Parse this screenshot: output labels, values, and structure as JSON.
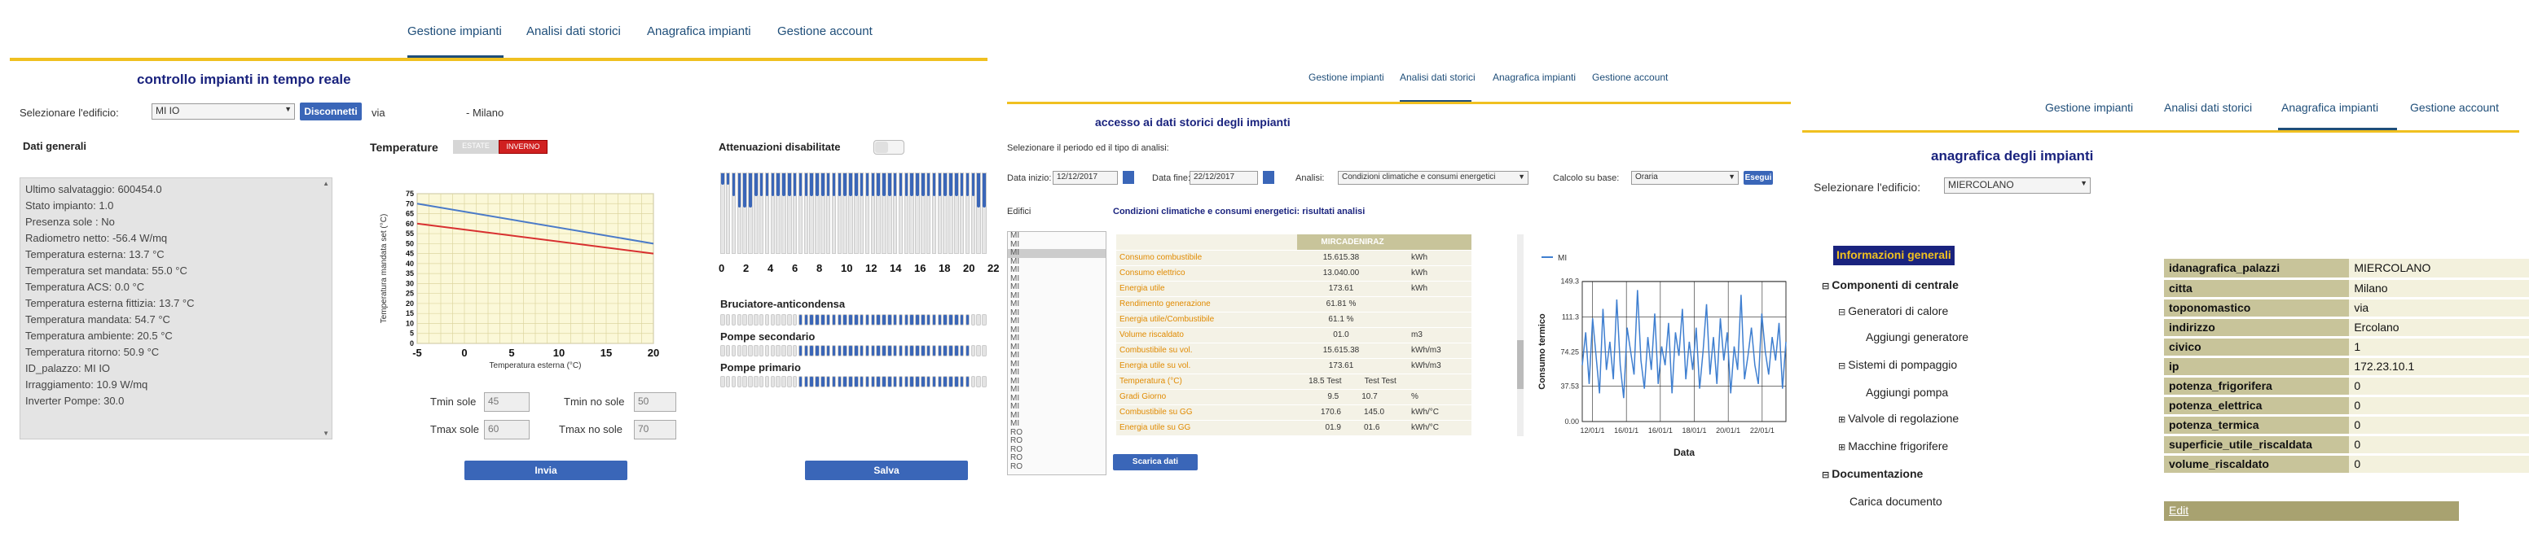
{
  "page1": {
    "nav": [
      "Gestione impianti",
      "Analisi dati storici",
      "Anagrafica impianti",
      "Gestione account"
    ],
    "title": "controllo impianti in tempo reale",
    "select_label": "Selezionare l'edificio:",
    "select_value": "MI                    IO",
    "disconnect_label": "Disconnetti",
    "address_via": "via",
    "address_city": "- Milano",
    "dati_generali_title": "Dati generali",
    "dati_generali_lines": [
      "Ultimo salvataggio: 600454.0",
      "Stato impianto: 1.0",
      "Presenza sole : No",
      "Radiometro netto: -56.4 W/mq",
      "Temperatura esterna: 13.7 °C",
      "Temperatura set mandata: 55.0 °C",
      "Temperatura ACS: 0.0 °C",
      "Temperatura esterna fittizia: 13.7 °C",
      "Temperatura mandata: 54.7 °C",
      "Temperatura ambiente: 20.5 °C",
      "Temperatura ritorno: 50.9 °C",
      "ID_palazzo: MI                    IO",
      "Irraggiamento: 10.9 W/mq",
      "Inverter Pompe: 30.0"
    ],
    "temperature_title": "Temperature",
    "toggle_estate": "ESTATE",
    "toggle_inverno": "INVERNO",
    "ylabel": "Temperatura mandata set (°C)",
    "xlabel": "Temperatura esterna (°C)",
    "tmin_sole_label": "Tmin sole",
    "tmin_sole_value": "45",
    "tmin_nosole_label": "Tmin no sole",
    "tmin_nosole_value": "50",
    "tmax_sole_label": "Tmax sole",
    "tmax_sole_value": "60",
    "tmax_nosole_label": "Tmax no sole",
    "tmax_nosole_value": "70",
    "invia_label": "Invia",
    "salva_label": "Salva",
    "attenuazioni_title": "Attenuazioni disabilitate",
    "attenuazioni_levels": [
      0.25,
      0.25,
      0.5,
      0.75,
      0.75,
      0.75,
      0.5,
      0.5,
      0.5,
      0.5,
      0.5,
      0.5,
      0.5,
      0.5,
      0.5,
      0.5,
      0.5,
      0.5,
      0.5,
      0.5,
      0.5,
      0.5,
      0.5,
      0.5,
      0.5,
      0.5,
      0.5,
      0.5,
      0.5,
      0.5,
      0.5,
      0.5,
      0.5,
      0.5,
      0.5,
      0.5,
      0.5,
      0.5,
      0.5,
      0.5,
      0.5,
      0.5,
      0.5,
      0.5,
      0.5,
      0.5,
      0.75,
      0.75
    ],
    "hour_ticks": [
      "0",
      "2",
      "4",
      "6",
      "8",
      "10",
      "12",
      "14",
      "16",
      "18",
      "20",
      "22"
    ],
    "bruciatore_title": "Bruciatore-anticondensa",
    "pompe_secondario_title": "Pompe secondario",
    "pompe_primario_title": "Pompe primario",
    "bruciatore_on": [
      0,
      0,
      0,
      0,
      0,
      0,
      0,
      0,
      0,
      0,
      0,
      0,
      0,
      0,
      1,
      1,
      1,
      1,
      1,
      1,
      1,
      1,
      1,
      1,
      1,
      1,
      1,
      1,
      1,
      1,
      1,
      1,
      1,
      1,
      1,
      1,
      1,
      1,
      1,
      1,
      1,
      1,
      1,
      1,
      1,
      0,
      0,
      0
    ],
    "secondario_on": [
      0,
      0,
      0,
      0,
      0,
      0,
      0,
      0,
      0,
      0,
      0,
      0,
      0,
      0,
      1,
      1,
      1,
      1,
      1,
      1,
      1,
      1,
      1,
      1,
      1,
      1,
      1,
      1,
      1,
      1,
      1,
      1,
      1,
      1,
      1,
      1,
      1,
      1,
      1,
      1,
      1,
      1,
      1,
      1,
      1,
      0,
      0,
      0
    ],
    "primario_on": [
      0,
      0,
      0,
      0,
      0,
      0,
      0,
      0,
      0,
      0,
      0,
      0,
      0,
      0,
      1,
      1,
      1,
      1,
      1,
      1,
      1,
      1,
      1,
      1,
      1,
      1,
      1,
      1,
      1,
      1,
      1,
      1,
      1,
      1,
      1,
      1,
      1,
      1,
      1,
      1,
      1,
      1,
      1,
      1,
      1,
      0,
      0,
      0
    ]
  },
  "chart_data": [
    {
      "type": "line",
      "title": "",
      "xlabel": "Temperatura esterna (°C)",
      "ylabel": "Temperatura mandata set (°C)",
      "xlim": [
        -5,
        20
      ],
      "ylim": [
        0,
        75
      ],
      "x_ticks": [
        "-5",
        "0",
        "5",
        "10",
        "15",
        "20"
      ],
      "y_ticks": [
        "0",
        "5",
        "10",
        "15",
        "20",
        "25",
        "30",
        "35",
        "40",
        "45",
        "50",
        "55",
        "60",
        "65",
        "70",
        "75"
      ],
      "series": [
        {
          "color": "#4a7ac8",
          "x": [
            -5,
            20
          ],
          "y": [
            70,
            50
          ]
        },
        {
          "color": "#d83030",
          "x": [
            -5,
            20
          ],
          "y": [
            60,
            45
          ]
        }
      ]
    },
    {
      "type": "line",
      "title": "",
      "xlabel": "Data",
      "ylabel": "Consumo termico",
      "legend": "top-left",
      "ylim": [
        0,
        149.06
      ],
      "y_ticks": [
        "0.00",
        "37.53",
        "74.25",
        "111.3",
        "149.3"
      ],
      "x_ticks": [
        "12/01/1",
        "16/01/1",
        "16/01/1",
        "18/01/1",
        "20/01/1",
        "22/01/1"
      ],
      "series": [
        {
          "name": "MI",
          "color": "#3f7fd0",
          "values": [
            60,
            95,
            40,
            110,
            70,
            30,
            120,
            55,
            85,
            45,
            130,
            60,
            25,
            100,
            75,
            50,
            140,
            65,
            35,
            90,
            55,
            115,
            40,
            80,
            60,
            105,
            30,
            95,
            70,
            120,
            45,
            85,
            55,
            100,
            35,
            75,
            125,
            50,
            90,
            40,
            110,
            65,
            95,
            30,
            80,
            55,
            135,
            45,
            70,
            100,
            60,
            40,
            115,
            75,
            50,
            90,
            65,
            105,
            35,
            85
          ]
        }
      ]
    }
  ],
  "page2": {
    "nav": [
      "Gestione impianti",
      "Analisi dati storici",
      "Anagrafica impianti",
      "Gestione account"
    ],
    "title": "accesso ai dati storici degli impianti",
    "period_label": "Selezionare il periodo ed il tipo di analisi:",
    "data_inizio_label": "Data inizio:",
    "data_inizio_value": "12/12/2017",
    "data_fine_label": "Data fine:",
    "data_fine_value": "22/12/2017",
    "analisi_label": "Analisi:",
    "analisi_value": "Condizioni climatiche e consumi energetici",
    "calcolo_label": "Calcolo su base:",
    "calcolo_value": "Oraria",
    "esegui_label": "Esegui",
    "edifici_label": "Edifici",
    "edifici_list": [
      "MI",
      "MI",
      "MI",
      "MI",
      "MI",
      "MI",
      "MI",
      "MI",
      "MI",
      "MI",
      "MI",
      "MI",
      "MI",
      "MI",
      "MI",
      "MI",
      "MI",
      "MI",
      "MI",
      "MI",
      "MI",
      "MI",
      "MI",
      "RO",
      "RO",
      "RO",
      "RO",
      "RO"
    ],
    "results_title": "Condizioni climatiche e consumi energetici: risultati analisi",
    "table_header": "MIRCADENIRAZ",
    "table_rows": [
      {
        "name": "Consumo combustibile",
        "v1": "15.615.38",
        "v2": "",
        "unit": "kWh"
      },
      {
        "name": "Consumo elettrico",
        "v1": "13.040.00",
        "v2": "",
        "unit": "kWh"
      },
      {
        "name": "Energia utile",
        "v1": "173.61",
        "v2": "",
        "unit": "kWh"
      },
      {
        "name": "Rendimento generazione",
        "v1": "61.81 %",
        "v2": "",
        "unit": ""
      },
      {
        "name": "Energia utile/Combustibile",
        "v1": "61.1 %",
        "v2": "",
        "unit": ""
      },
      {
        "name": "Volume riscaldato",
        "v1": "01.0",
        "v2": "",
        "unit": "m3"
      },
      {
        "name": "Combustibile su vol.",
        "v1": "15.615.38",
        "v2": "",
        "unit": "kWh/m3"
      },
      {
        "name": "Energia utile su vol.",
        "v1": "173.61",
        "v2": "",
        "unit": "kWh/m3"
      },
      {
        "name": "Temperatura (°C)",
        "v1": "18.5 Test",
        "v2": "Test Test",
        "unit": ""
      },
      {
        "name": "Gradi Giorno",
        "v1": "9.5",
        "v2": "10.7",
        "unit": "%"
      },
      {
        "name": "Combustibile su GG",
        "v1": "170.6",
        "v2": "145.0",
        "unit": "kWh/°C"
      },
      {
        "name": "Energia utile su GG",
        "v1": "01.9",
        "v2": "01.6",
        "unit": "kWh/°C"
      }
    ],
    "scarica_label": "Scarica dati",
    "chart_legend": "MI",
    "chart_ylabel": "Consumo termico",
    "chart_xlabel": "Data"
  },
  "page3": {
    "nav": [
      "Gestione impianti",
      "Analisi dati storici",
      "Anagrafica impianti",
      "Gestione account"
    ],
    "title": "anagrafica degli impianti",
    "select_label": "Selezionare l'edificio:",
    "select_value": "MIERCOLANO",
    "tree_header": "Informazioni generali",
    "tree": {
      "componenti": "Componenti di centrale",
      "generatori": "Generatori di calore",
      "aggiungi_generatore": "Aggiungi generatore",
      "pompaggio": "Sistemi di pompaggio",
      "aggiungi_pompa": "Aggiungi pompa",
      "valvole": "Valvole di regolazione",
      "macchine": "Macchine frigorifere",
      "documentazione": "Documentazione",
      "carica": "Carica documento"
    },
    "info_rows": [
      {
        "key": "idanagrafica_palazzi",
        "value": "MIERCOLANO"
      },
      {
        "key": "citta",
        "value": "Milano"
      },
      {
        "key": "toponomastico",
        "value": "via"
      },
      {
        "key": "indirizzo",
        "value": "Ercolano"
      },
      {
        "key": "civico",
        "value": "1"
      },
      {
        "key": "ip",
        "value": "172.23.10.1"
      },
      {
        "key": "potenza_frigorifera",
        "value": "0"
      },
      {
        "key": "potenza_elettrica",
        "value": "0"
      },
      {
        "key": "potenza_termica",
        "value": "0"
      },
      {
        "key": "superficie_utile_riscaldata",
        "value": "0"
      },
      {
        "key": "volume_riscaldato",
        "value": "0"
      }
    ],
    "edit_label": "Edit"
  }
}
